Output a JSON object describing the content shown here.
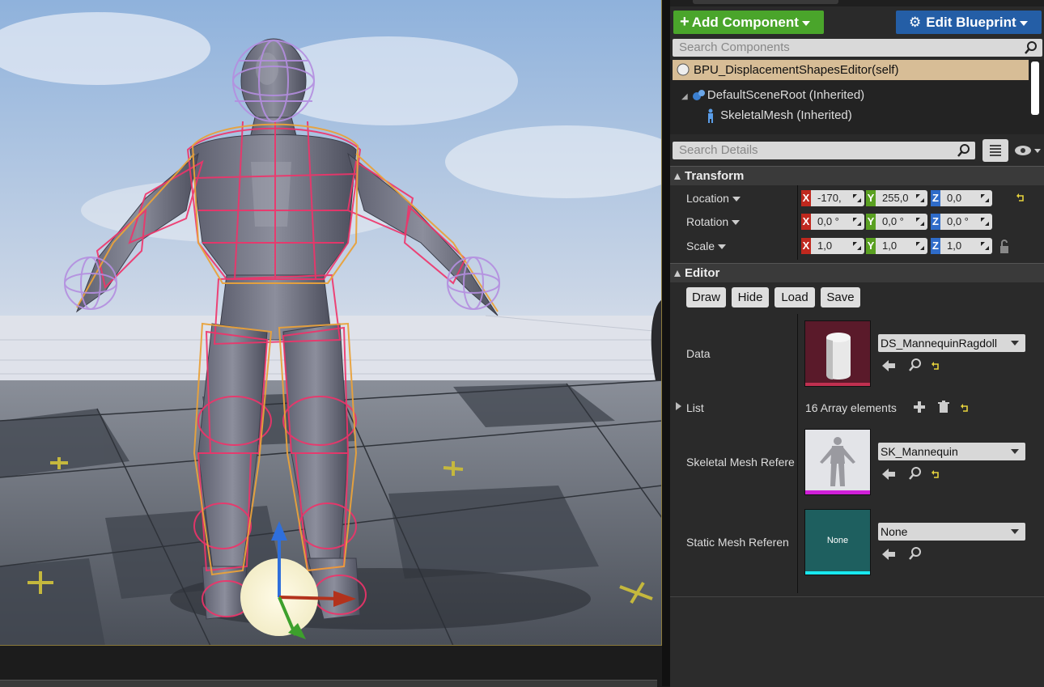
{
  "toolbar": {
    "add_component_label": "Add Component",
    "edit_blueprint_label": "Edit Blueprint"
  },
  "components": {
    "search_placeholder": "Search Components",
    "self_item": "BPU_DisplacementShapesEditor(self)",
    "items": [
      {
        "label": "DefaultSceneRoot (Inherited)"
      },
      {
        "label": "SkeletalMesh (Inherited)"
      }
    ]
  },
  "details": {
    "search_placeholder": "Search Details"
  },
  "transform": {
    "title": "Transform",
    "location": {
      "label": "Location",
      "x": "-170,",
      "y": "255,0",
      "z": "0,0"
    },
    "rotation": {
      "label": "Rotation",
      "x": "0,0 °",
      "y": "0,0 °",
      "z": "0,0 °"
    },
    "scale": {
      "label": "Scale",
      "x": "1,0",
      "y": "1,0",
      "z": "1,0"
    },
    "axis_labels": {
      "x": "X",
      "y": "Y",
      "z": "Z"
    }
  },
  "editor": {
    "title": "Editor",
    "buttons": {
      "draw": "Draw",
      "hide": "Hide",
      "load": "Load",
      "save": "Save"
    },
    "data": {
      "label": "Data",
      "value": "DS_MannequinRagdoll"
    },
    "list": {
      "label": "List",
      "value": "16 Array elements"
    },
    "skeletal": {
      "label": "Skeletal Mesh Refere",
      "value": "SK_Mannequin"
    },
    "static": {
      "label": "Static Mesh Referen",
      "value": "None",
      "thumb_text": "None"
    }
  },
  "colors": {
    "add_green": "#4aa52b",
    "edit_blue": "#245ea6",
    "selection": "#d7bd96",
    "axis_x": "#c0281e",
    "axis_y": "#5aa021",
    "axis_z": "#2f6cc9"
  }
}
